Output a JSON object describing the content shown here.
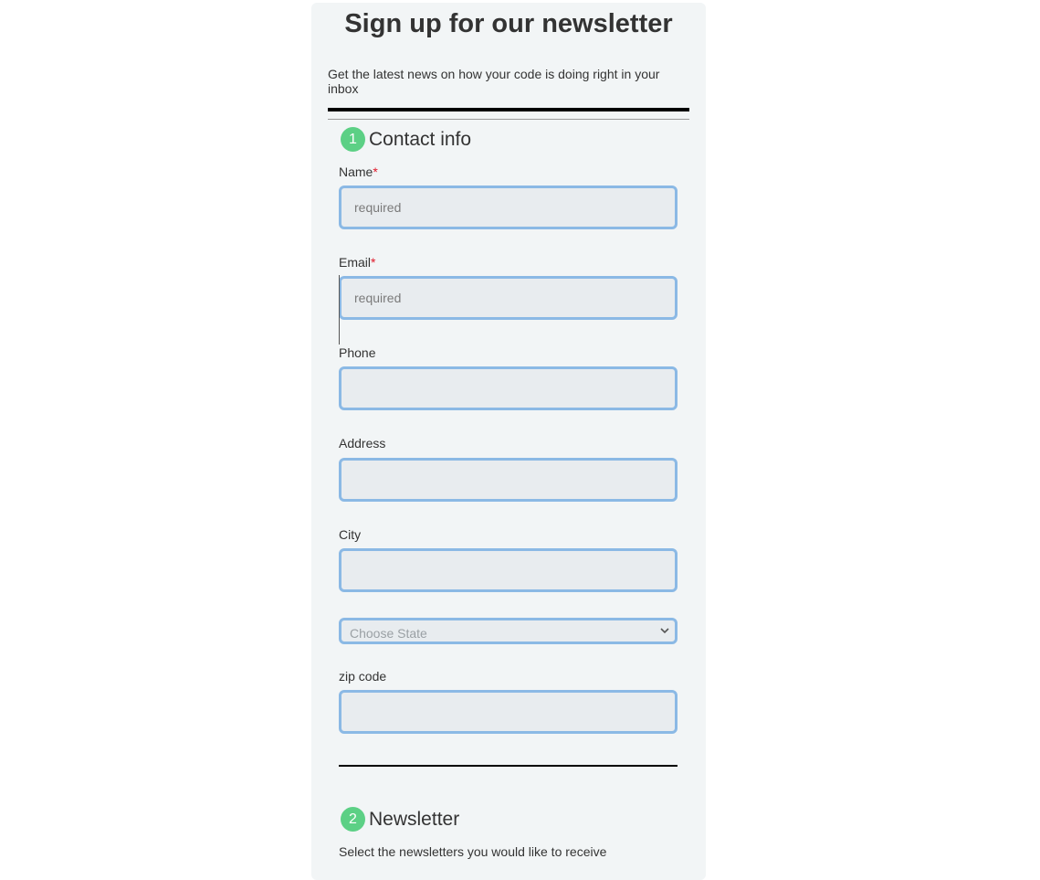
{
  "page": {
    "title": "Sign up for our newsletter",
    "intro": "Get the latest news on how your code is doing right in your inbox"
  },
  "contact_section": {
    "step": "1",
    "title": "Contact info",
    "required_marker": "*",
    "fields": {
      "name": {
        "label": "Name",
        "placeholder": "required",
        "value": ""
      },
      "email": {
        "label": "Email",
        "placeholder": "required",
        "value": ""
      },
      "phone": {
        "label": "Phone",
        "placeholder": "",
        "value": ""
      },
      "address": {
        "label": "Address",
        "placeholder": "",
        "value": ""
      },
      "city": {
        "label": "City",
        "placeholder": "",
        "value": ""
      },
      "state": {
        "selected": "Choose State"
      },
      "zip": {
        "label": "zip code",
        "placeholder": "",
        "value": ""
      }
    }
  },
  "newsletter_section": {
    "step": "2",
    "title": "Newsletter",
    "intro": "Select the newsletters you would like to receive"
  },
  "colors": {
    "accent_badge": "#5cd085",
    "input_border": "#8bb9e5",
    "required_marker": "#e0192a"
  }
}
